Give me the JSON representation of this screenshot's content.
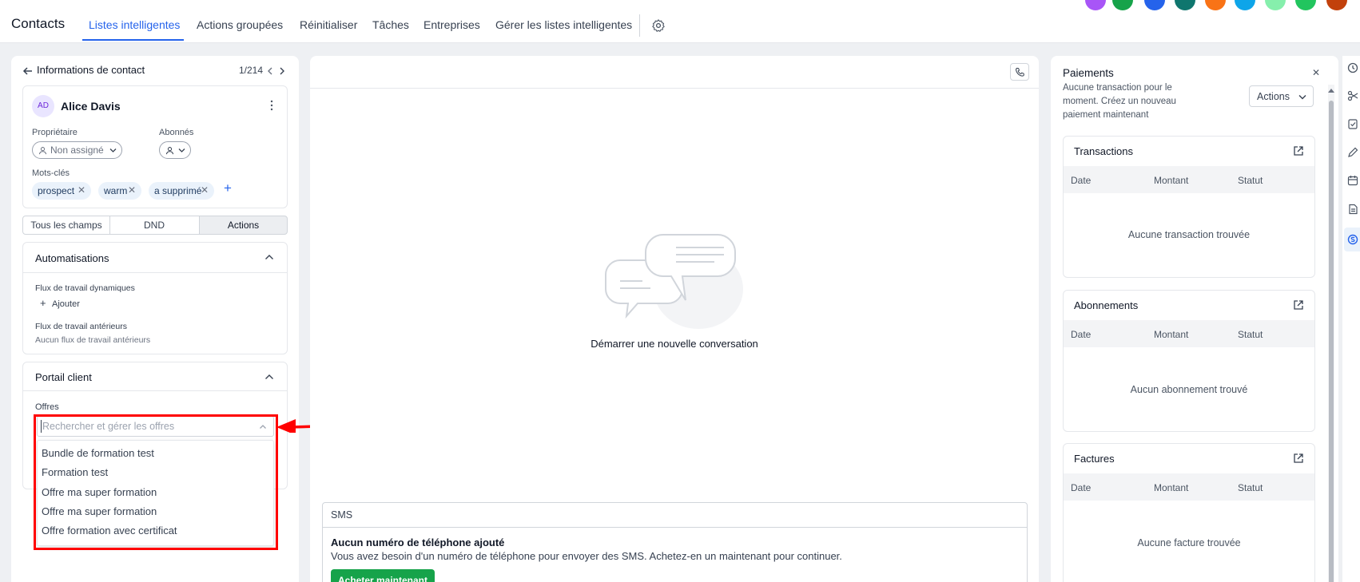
{
  "header": {
    "app_title": "Contacts",
    "tabs": [
      "Listes intelligentes",
      "Actions groupées",
      "Réinitialiser",
      "Tâches",
      "Entreprises",
      "Gérer les listes intelligentes"
    ],
    "avatar_colors": [
      "#a855f7",
      "#16a34a",
      "#2563eb",
      "#0f766e",
      "#f97316",
      "#0ea5e9",
      "#86efac",
      "#22c55e",
      "#c2410c"
    ]
  },
  "contact": {
    "panel_title": "Informations de contact",
    "pager": "1/214",
    "initials": "AD",
    "name": "Alice Davis",
    "owner_label": "Propriétaire",
    "owner_value": "Non assigné",
    "followers_label": "Abonnés",
    "tags_label": "Mots-clés",
    "tags": [
      "prospect",
      "warm",
      "a supprimé"
    ],
    "segments": [
      "Tous les champs",
      "DND",
      "Actions"
    ],
    "automations": {
      "title": "Automatisations",
      "active_label": "Flux de travail dynamiques",
      "add_label": "Ajouter",
      "past_label": "Flux de travail antérieurs",
      "past_empty": "Aucun flux de travail antérieurs"
    },
    "portal": {
      "title": "Portail client",
      "offers_label": "Offres",
      "search_placeholder": "Rechercher et gérer les offres",
      "options": [
        "Bundle de formation test",
        "Formation test",
        "Offre ma super formation",
        "Offre ma super formation",
        "Offre formation avec certificat"
      ]
    }
  },
  "conversation": {
    "empty_title": "Démarrer une nouvelle conversation",
    "sms_tab": "SMS",
    "no_phone_title": "Aucun numéro de téléphone ajouté",
    "no_phone_text": "Vous avez besoin d'un numéro de téléphone pour envoyer des SMS. Achetez-en un maintenant pour continuer.",
    "buy_button": "Acheter maintenant"
  },
  "payments": {
    "title": "Paiements",
    "subtitle_lines": [
      "Aucune transaction pour le",
      "moment. Créez un nouveau",
      "paiement maintenant"
    ],
    "actions_label": "Actions",
    "sections": [
      {
        "title": "Transactions",
        "columns": [
          "Date",
          "Montant",
          "Statut"
        ],
        "empty": "Aucune transaction trouvée"
      },
      {
        "title": "Abonnements",
        "columns": [
          "Date",
          "Montant",
          "Statut"
        ],
        "empty": "Aucun abonnement trouvé"
      },
      {
        "title": "Factures",
        "columns": [
          "Date",
          "Montant",
          "Statut"
        ],
        "empty": "Aucune facture trouvée"
      }
    ]
  },
  "colors": {
    "accent": "#2563eb",
    "highlight": "#ff0000",
    "primary_button": "#16a34a"
  }
}
